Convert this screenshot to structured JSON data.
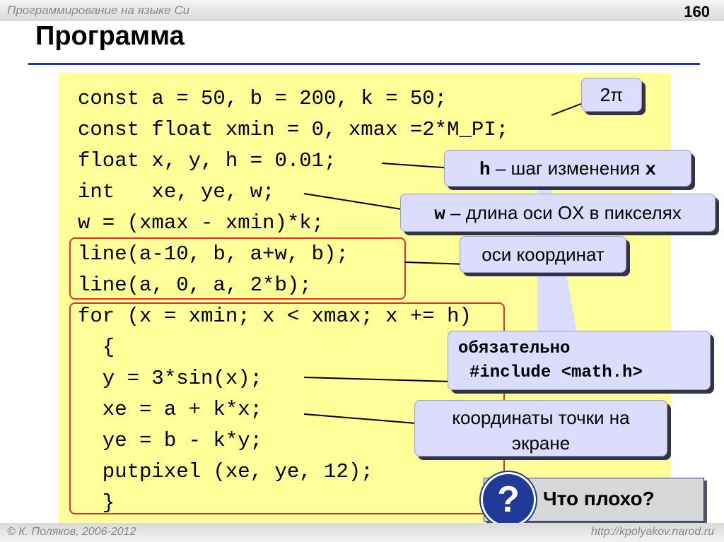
{
  "header": {
    "course": "Программирование на языке Си",
    "slide_number": "160"
  },
  "title": "Программа",
  "code_lines": [
    "const a = 50, b = 200, k = 50;",
    "const float xmin = 0, xmax =2*M_PI;",
    "float x, y, h = 0.01;",
    "int   xe, ye, w;",
    "w = (xmax - xmin)*k;",
    "line(a-10, b, a+w, b);",
    "line(a, 0, a, 2*b);",
    "for (x = xmin; x < xmax; x += h)",
    "  {",
    "  y = 3*sin(x);",
    "  xe = a + k*x;",
    "  ye = b - k*y;",
    "  putpixel (xe, ye, 12);",
    "  }"
  ],
  "callouts": {
    "two_pi": "2π",
    "h_var": "h",
    "h_text": " – шаг изменения ",
    "h_x": "x",
    "w_var": "w",
    "w_text": " – длина оси OX в пикселях",
    "axes": "оси координат",
    "include_line1": "обязательно",
    "include_line2": "#include <math.h>",
    "coords_line1": "координаты точки на",
    "coords_line2": "экране"
  },
  "question": {
    "symbol": "?",
    "text": "Что плохо?"
  },
  "footer": {
    "copyright": "© К. Поляков, 2006-2012",
    "site": "http://kpolyakov.narod.ru"
  },
  "colors": {
    "code_background": "#ffff99",
    "callout_background": "#dcdcfc",
    "accent": "#1f3a99",
    "frame_red": "#e03030"
  }
}
